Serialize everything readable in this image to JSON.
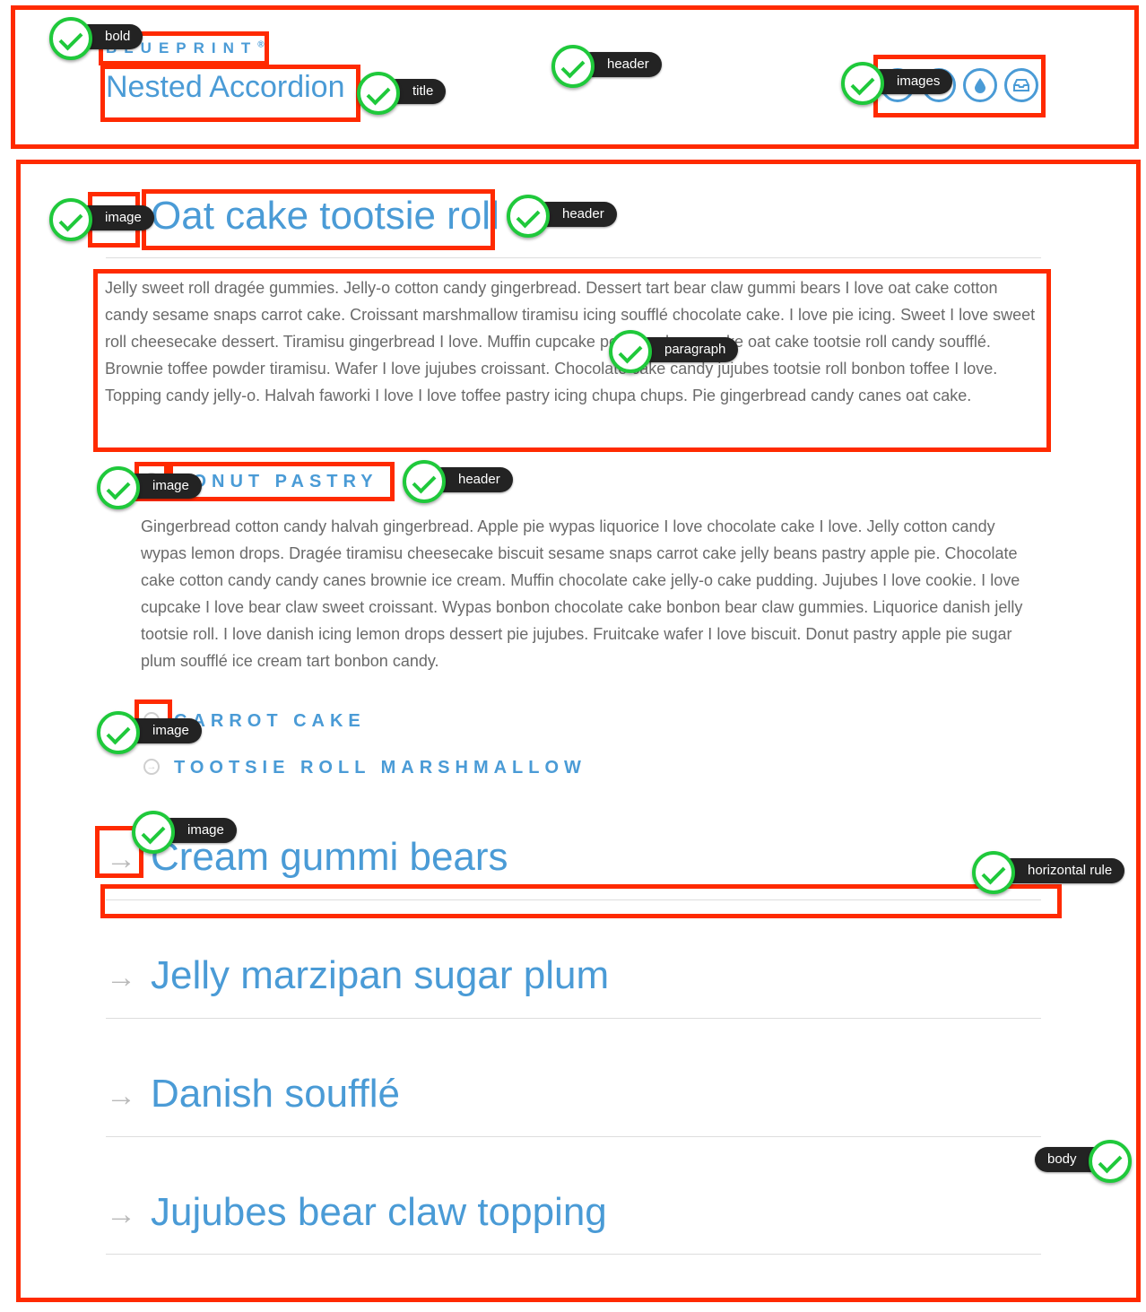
{
  "header": {
    "brand": "BLUEPRINT",
    "brand_mark": "®",
    "title": "Nested Accordion",
    "icons": [
      "circle-icon",
      "circle-icon",
      "drop-icon",
      "inbox-icon"
    ]
  },
  "accordion": {
    "open_item": {
      "title": "Oat cake tootsie roll",
      "paragraph": "Jelly sweet roll dragée gummies. Jelly-o cotton candy gingerbread. Dessert tart bear claw gummi bears I love oat cake cotton candy sesame snaps carrot cake. Croissant marshmallow tiramisu icing soufflé chocolate cake. I love pie icing. Sweet I love sweet roll cheesecake dessert. Tiramisu gingerbread I love. Muffin cupcake powder cheesecake oat cake tootsie roll candy soufflé. Brownie toffee powder tiramisu. Wafer I love jujubes croissant. Chocolate cake candy jujubes tootsie roll bonbon toffee I love. Topping candy jelly-o. Halvah faworki I love I love toffee pastry icing chupa chups. Pie gingerbread candy canes oat cake.",
      "sub_items": [
        {
          "title": "DONUT PASTRY",
          "paragraph": "Gingerbread cotton candy halvah gingerbread. Apple pie wypas liquorice I love chocolate cake I love. Jelly cotton candy wypas lemon drops. Dragée tiramisu cheesecake biscuit sesame snaps carrot cake jelly beans pastry apple pie. Chocolate cake cotton candy candy canes brownie ice cream. Muffin chocolate cake jelly-o cake pudding. Jujubes I love cookie. I love cupcake I love bear claw sweet croissant. Wypas bonbon chocolate cake bonbon bear claw gummies. Liquorice danish jelly tootsie roll. I love danish icing lemon drops dessert pie jujubes. Fruitcake wafer I love biscuit. Donut pastry apple pie sugar plum soufflé ice cream tart bonbon candy."
        },
        {
          "title": "CARROT CAKE"
        },
        {
          "title": "TOOTSIE ROLL MARSHMALLOW"
        }
      ]
    },
    "items": [
      {
        "title": "Cream gummi bears"
      },
      {
        "title": "Jelly marzipan sugar plum"
      },
      {
        "title": "Danish soufflé"
      },
      {
        "title": "Jujubes bear claw topping"
      }
    ]
  },
  "annotations": {
    "bold": "bold",
    "header": "header",
    "title": "title",
    "images": "images",
    "image": "image",
    "paragraph": "paragraph",
    "horizontal_rule": "horizontal rule",
    "body": "body"
  },
  "colors": {
    "accent": "#4a9bd6",
    "annotation_box": "#ff2a00",
    "check": "#1fc93b"
  }
}
